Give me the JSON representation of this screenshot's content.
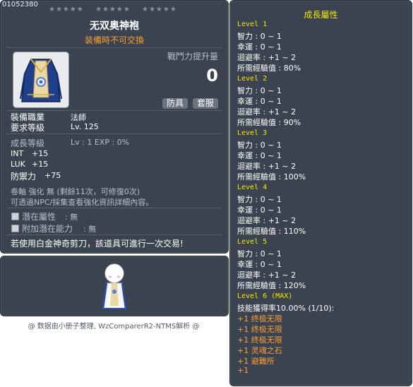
{
  "item": {
    "id": "01052380",
    "stars": [
      "★★★★★",
      "★★★★★",
      "★★★★★"
    ],
    "name": "无双奥神袍",
    "trade_note": "装備時不可交換",
    "power_label": "戰鬥力提升量",
    "power_value": "0",
    "tag_defense": "防具",
    "tag_cape": "套服",
    "job_label": "裝備職業",
    "job_value": "法師",
    "req_label": "要求等級",
    "req_value": "Lv. 125",
    "growth_label": "成長等級",
    "growth_value": "Lv : 1    EXP : 0%",
    "stats": [
      {
        "name": "INT",
        "value": "+15"
      },
      {
        "name": "LUK",
        "value": "+15"
      },
      {
        "name": "防禦力",
        "value": "+75"
      }
    ],
    "scroll_line": "卷軸 強化 無 (剩餘11次，可修復0次)",
    "npc_line": "可透過NPC/採集查看強化資訊詳細內容。",
    "potential_label": "潛在屬性",
    "potential_value": ": 無",
    "addpot_label": "附加潛在能力",
    "addpot_value": ": 無",
    "scissors_note": "若使用白金神奇剪刀，該道具可進行一次交易!"
  },
  "growth": {
    "title": "成長屬性",
    "levels": [
      {
        "label": "Level 1",
        "stats": [
          "智力 : 0 ~ 1",
          "幸運 : 0 ~ 1",
          "迴避率 : +1 ~ 2",
          "所需經驗值 : 80%"
        ]
      },
      {
        "label": "Level 2",
        "stats": [
          "智力 : 0 ~ 1",
          "幸運 : 0 ~ 1",
          "迴避率 : +1 ~ 2",
          "所需經驗值 : 90%"
        ]
      },
      {
        "label": "Level 3",
        "stats": [
          "智力 : 0 ~ 1",
          "幸運 : 0 ~ 1",
          "迴避率 : +1 ~ 2",
          "所需經驗值 : 100%"
        ]
      },
      {
        "label": "Level 4",
        "stats": [
          "智力 : 0 ~ 1",
          "幸運 : 0 ~ 1",
          "迴避率 : +1 ~ 2",
          "所需經驗值 : 110%"
        ]
      },
      {
        "label": "Level 5",
        "stats": [
          "智力 : 0 ~ 1",
          "幸運 : 0 ~ 1",
          "迴避率 : +1 ~ 2",
          "所需經驗值 : 120%"
        ]
      }
    ],
    "level6": {
      "label": "Level 6 (MAX)",
      "skill_line": "技能獲得率10.00% (1/10):",
      "bonuses": [
        "+1 终极无限",
        "+1 终极无限",
        "+1 终极无限",
        "+1 灵魂之石",
        "+1 避難所",
        "+1"
      ]
    }
  },
  "credit": "@ 数据由小册子整理, WzComparerR2-NTMS解析 @",
  "colors": {
    "panel": "#3b4350",
    "level_yellow": "#f3e800",
    "bonus_orange": "#ff9f33"
  }
}
